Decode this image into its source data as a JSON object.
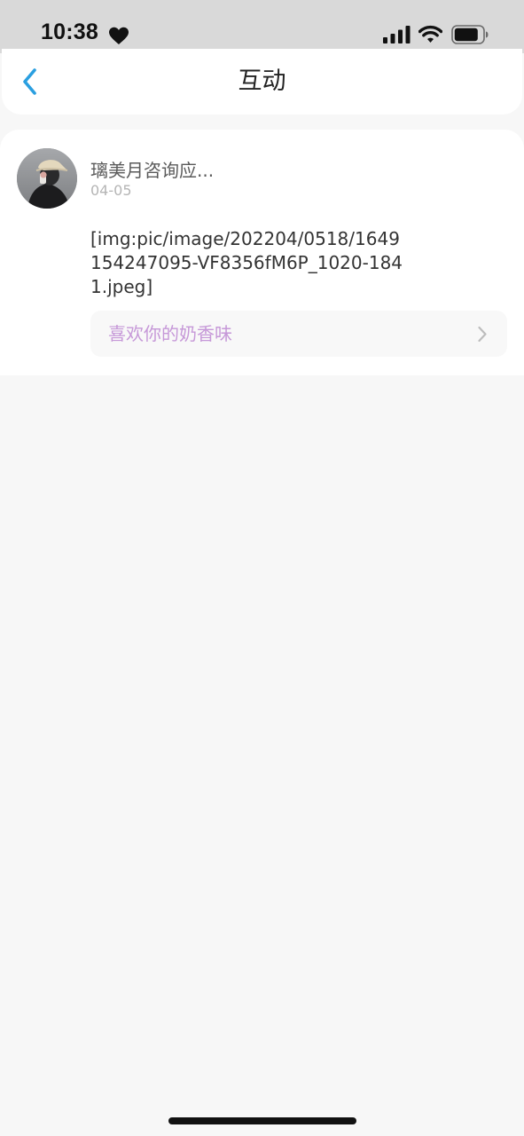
{
  "status_bar": {
    "time": "10:38"
  },
  "header": {
    "title": "互动",
    "back_icon": "chevron-left-icon"
  },
  "post": {
    "user_name": "璃美月咨询应...",
    "date": "04-05",
    "content": "[img:pic/image/202204/0518/1649154247095-VF8356fM6P_1020-1841.jpeg]",
    "reply": "喜欢你的奶香味"
  },
  "colors": {
    "accent": "#2a9fe0",
    "reply_text": "#c698d8",
    "status_bar_bg": "#d9d9d9",
    "page_bg": "#f7f7f7"
  }
}
